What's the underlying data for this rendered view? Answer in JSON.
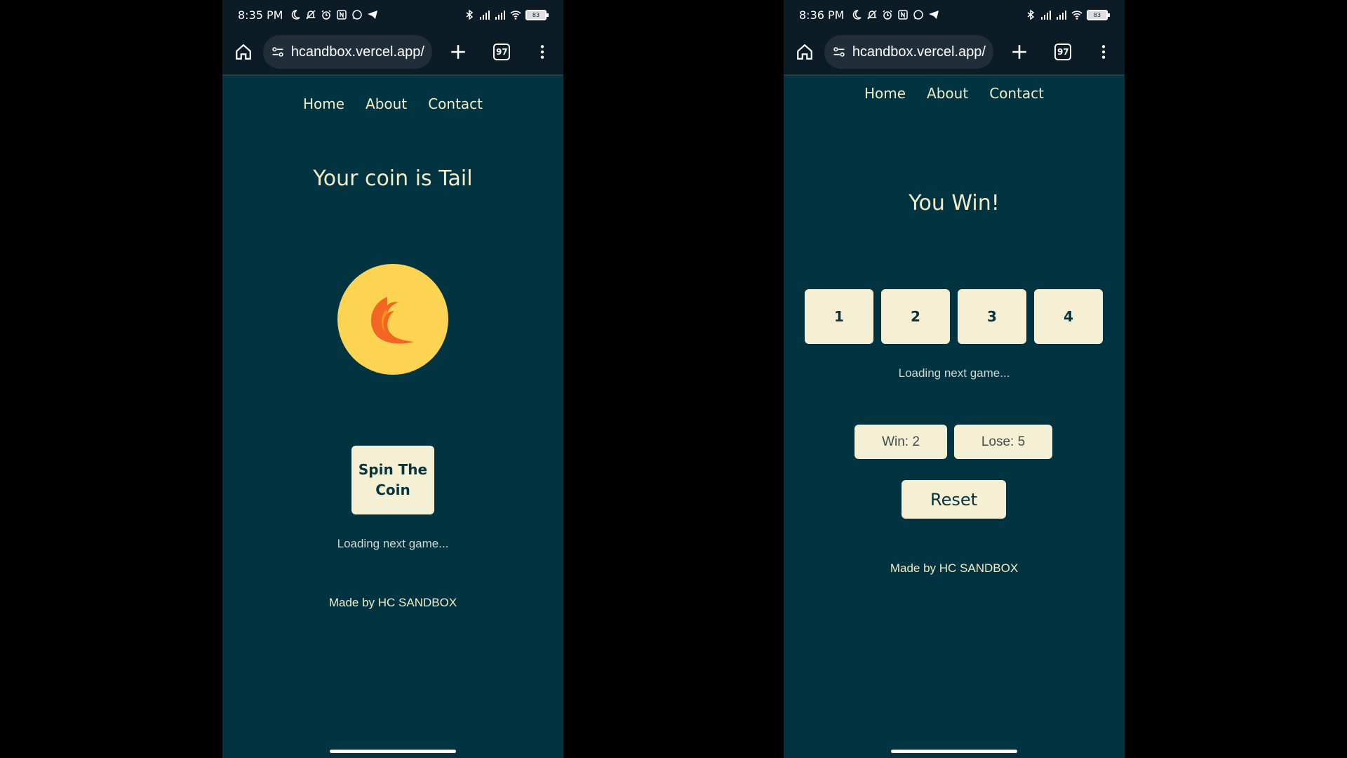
{
  "left_phone": {
    "status": {
      "time": "8:35 PM",
      "battery": "83"
    },
    "browser": {
      "url": "hcandbox.vercel.app/",
      "tab_count": "97"
    },
    "nav": {
      "home": "Home",
      "about": "About",
      "contact": "Contact"
    },
    "title": "Your coin is Tail",
    "coin": {
      "icon": "fox-tail-icon",
      "face": "Tail"
    },
    "spin_button": {
      "line1": "Spin The",
      "line2": "Coin"
    },
    "loading_text": "Loading next game...",
    "credit": "Made by HC SANDBOX"
  },
  "right_phone": {
    "status": {
      "time": "8:36 PM",
      "battery": "83"
    },
    "browser": {
      "url": "hcandbox.vercel.app/",
      "tab_count": "97"
    },
    "nav": {
      "home": "Home",
      "about": "About",
      "contact": "Contact"
    },
    "title": "You Win!",
    "choices": [
      "1",
      "2",
      "3",
      "4"
    ],
    "loading_text": "Loading next game...",
    "score": {
      "win": "Win: 2",
      "lose": "Lose: 5"
    },
    "reset_label": "Reset",
    "credit": "Made by HC SANDBOX"
  },
  "colors": {
    "page_bg": "#013440",
    "browser_bg": "#0b1c27",
    "cream": "#f5f0d3",
    "text_cream": "#f2ecc7",
    "coin": "#fdd352",
    "tail_orange": "#f26522"
  }
}
